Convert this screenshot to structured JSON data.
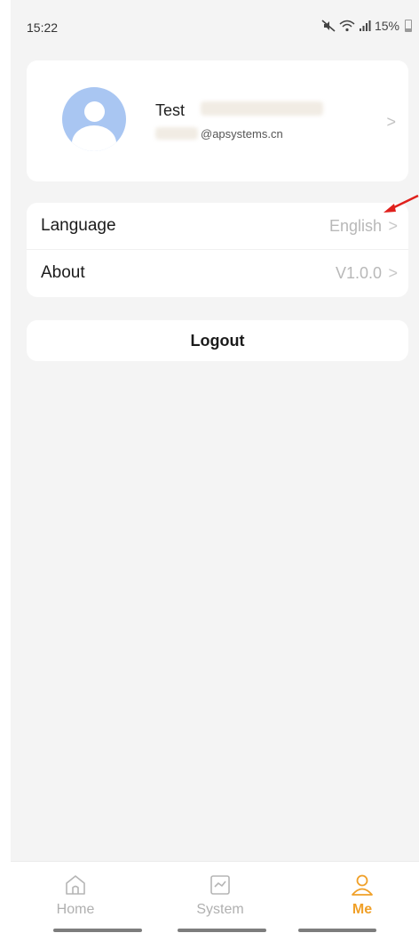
{
  "status_bar": {
    "time": "15:22",
    "battery": "15%",
    "icons": [
      "mute-icon",
      "wifi-icon",
      "signal-icon",
      "battery-icon"
    ]
  },
  "profile": {
    "name": "Test",
    "email": "@apsystems.cn",
    "chevron": ">"
  },
  "settings": {
    "language_label": "Language",
    "language_value": "English",
    "about_label": "About",
    "about_value": "V1.0.0",
    "chevron": ">"
  },
  "logout": {
    "label": "Logout"
  },
  "bottom_nav": {
    "items": [
      {
        "label": "Home",
        "icon": "home-icon",
        "active": false
      },
      {
        "label": "System",
        "icon": "chart-icon",
        "active": false
      },
      {
        "label": "Me",
        "icon": "user-icon",
        "active": true
      }
    ]
  },
  "colors": {
    "accent": "#f0a028",
    "background": "#f4f4f4",
    "card": "#ffffff",
    "avatar": "#a9c6f2",
    "annotation": "#e0201c"
  }
}
